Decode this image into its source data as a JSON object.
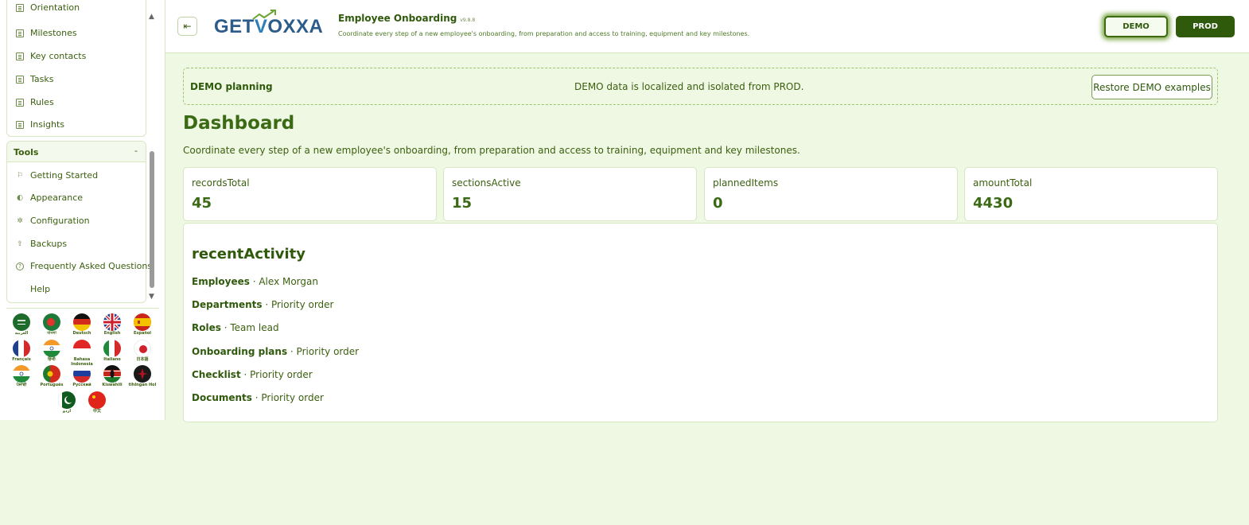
{
  "sidebar": {
    "nav_items": [
      {
        "label": "Orientation",
        "icon": "document-icon"
      },
      {
        "label": "Milestones",
        "icon": "document-icon"
      },
      {
        "label": "Key contacts",
        "icon": "document-icon"
      },
      {
        "label": "Tasks",
        "icon": "document-icon"
      },
      {
        "label": "Rules",
        "icon": "document-icon"
      },
      {
        "label": "Insights",
        "icon": "document-icon"
      }
    ],
    "tools": {
      "title": "Tools",
      "toggle": "-",
      "items": [
        {
          "label": "Getting Started",
          "icon": "flag-icon",
          "glyph": "⚐"
        },
        {
          "label": "Appearance",
          "icon": "palette-icon",
          "glyph": "◐"
        },
        {
          "label": "Configuration",
          "icon": "gear-icon",
          "glyph": "✲"
        },
        {
          "label": "Backups",
          "icon": "upload-icon",
          "glyph": "⇧"
        },
        {
          "label": "Frequently Asked Questions",
          "icon": "question-icon",
          "glyph": "?"
        },
        {
          "label": "Help",
          "icon": "",
          "glyph": ""
        }
      ]
    },
    "languages": [
      {
        "label": "العربية",
        "flag": "saudi"
      },
      {
        "label": "বাংলা",
        "flag": "bangladesh"
      },
      {
        "label": "Deutsch",
        "flag": "germany"
      },
      {
        "label": "English",
        "flag": "uk"
      },
      {
        "label": "Español",
        "flag": "spain"
      },
      {
        "label": "Français",
        "flag": "france"
      },
      {
        "label": "हिन्दी",
        "flag": "india"
      },
      {
        "label": "Bahasa Indonesia",
        "flag": "indonesia"
      },
      {
        "label": "Italiano",
        "flag": "italy"
      },
      {
        "label": "日本語",
        "flag": "japan"
      },
      {
        "label": "ਪੰਜਾਬੀ",
        "flag": "india"
      },
      {
        "label": "Português",
        "flag": "portugal"
      },
      {
        "label": "Русский",
        "flag": "russia"
      },
      {
        "label": "Kiswahili",
        "flag": "kenya"
      },
      {
        "label": "tlhIngan Hol",
        "flag": "klingon"
      },
      {
        "label": "اردو",
        "flag": "pakistan"
      },
      {
        "label": "中文",
        "flag": "china"
      }
    ]
  },
  "header": {
    "menu_icon": "⇤",
    "logo_text_left": "GET",
    "logo_text_v": "V",
    "logo_text_right": "OXXA",
    "app_title": "Employee Onboarding",
    "app_version": "v9.8.8",
    "app_subtitle": "Coordinate every step of a new employee's onboarding, from preparation and access to training, equipment and key milestones.",
    "demo_label": "DEMO",
    "prod_label": "PROD"
  },
  "banner": {
    "title": "DEMO planning",
    "message": "DEMO data is localized and isolated from PROD.",
    "restore_label": "Restore DEMO examples"
  },
  "dashboard": {
    "title": "Dashboard",
    "description": "Coordinate every step of a new employee's onboarding, from preparation and access to training, equipment and key milestones.",
    "stats": [
      {
        "label": "recordsTotal",
        "value": "45"
      },
      {
        "label": "sectionsActive",
        "value": "15"
      },
      {
        "label": "plannedItems",
        "value": "0"
      },
      {
        "label": "amountTotal",
        "value": "4430"
      }
    ],
    "activity": {
      "title": "recentActivity",
      "rows": [
        {
          "section": "Employees",
          "detail": "· Alex Morgan"
        },
        {
          "section": "Departments",
          "detail": "· Priority order"
        },
        {
          "section": "Roles",
          "detail": "· Team lead"
        },
        {
          "section": "Onboarding plans",
          "detail": "· Priority order"
        },
        {
          "section": "Checklist",
          "detail": "· Priority order"
        },
        {
          "section": "Documents",
          "detail": "· Priority order"
        }
      ]
    }
  },
  "colors": {
    "brand_green": "#2f5a0c",
    "page_bg": "#eff8e3",
    "border": "#d6e7c2"
  }
}
